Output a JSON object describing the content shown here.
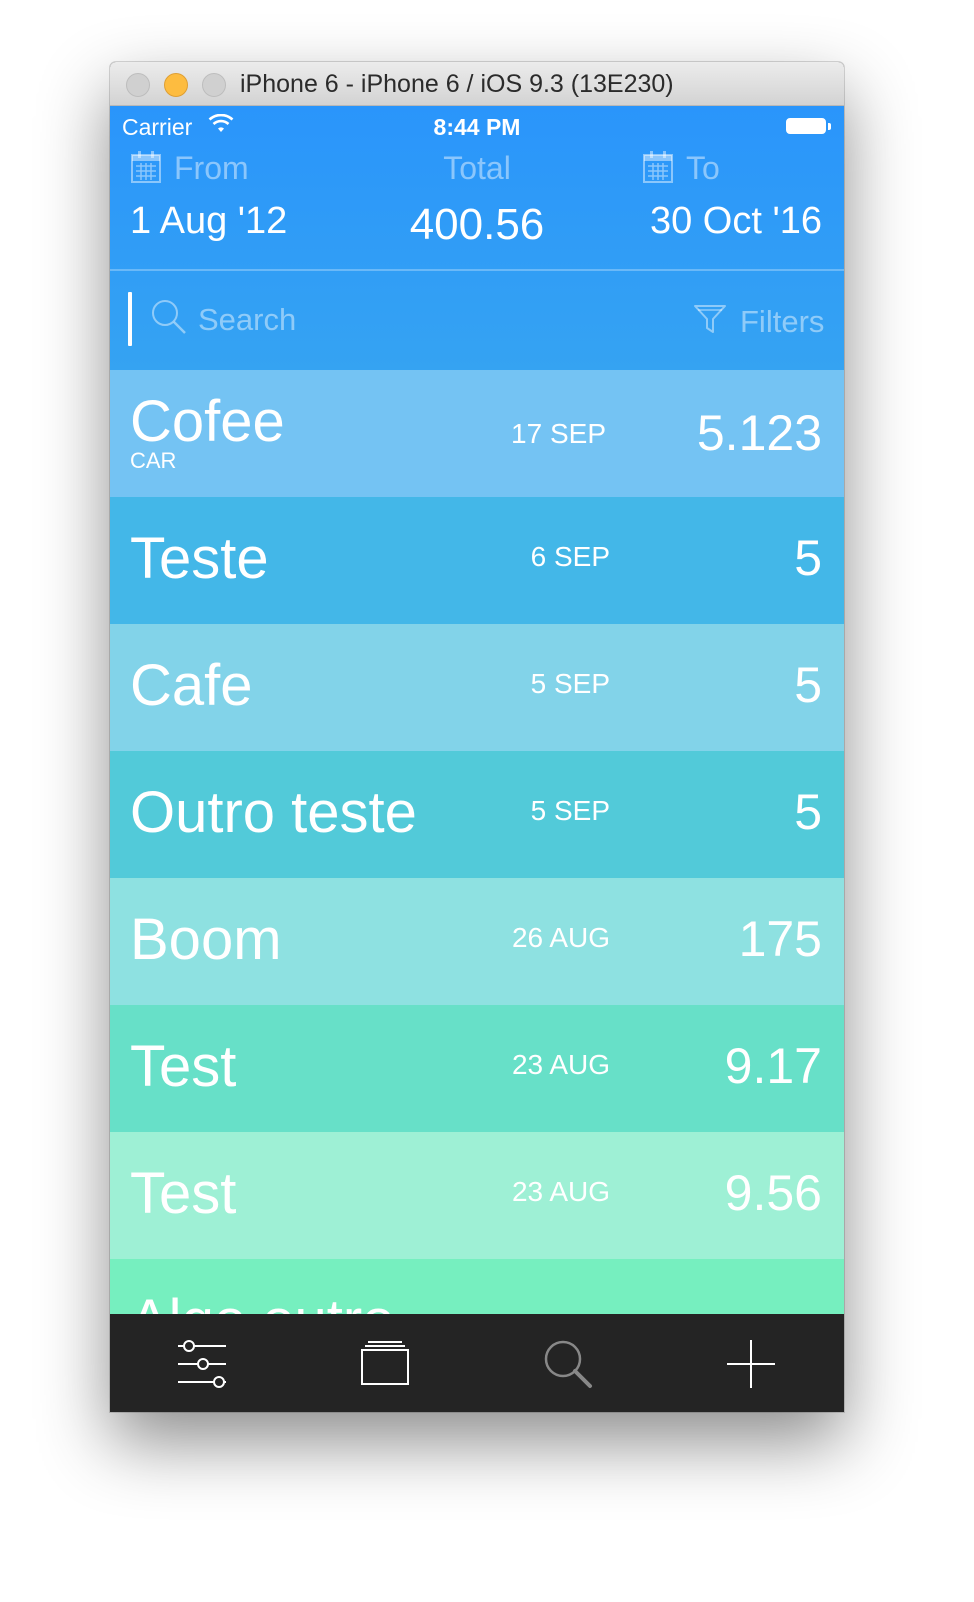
{
  "window": {
    "title": "iPhone 6 - iPhone 6 / iOS 9.3 (13E230)"
  },
  "status_bar": {
    "carrier": "Carrier",
    "time": "8:44 PM"
  },
  "header": {
    "from_label": "From",
    "from_value": "1 Aug '12",
    "total_label": "Total",
    "total_value": "400.56",
    "to_label": "To",
    "to_value": "30 Oct '16"
  },
  "search": {
    "placeholder": "Search",
    "filters_label": "Filters"
  },
  "rows": [
    {
      "name": "Cofee",
      "sub": "CAR",
      "date": "17 SEP",
      "amount": "5.123",
      "color": "#74c3f3"
    },
    {
      "name": "Teste",
      "sub": "",
      "date": "6 SEP",
      "amount": "5",
      "color": "#43b7e8"
    },
    {
      "name": "Cafe",
      "sub": "",
      "date": "5 SEP",
      "amount": "5",
      "color": "#82d3e9"
    },
    {
      "name": "Outro teste",
      "sub": "",
      "date": "5 SEP",
      "amount": "5",
      "color": "#52cad9"
    },
    {
      "name": "Boom",
      "sub": "",
      "date": "26 AUG",
      "amount": "175",
      "color": "#8ee1e1"
    },
    {
      "name": "Test",
      "sub": "",
      "date": "23 AUG",
      "amount": "9.17",
      "color": "#67e0c8"
    },
    {
      "name": "Test",
      "sub": "",
      "date": "23 AUG",
      "amount": "9.56",
      "color": "#9ef0d5"
    },
    {
      "name": "Algo outro",
      "sub": "",
      "date": "",
      "amount": "",
      "color": "#76efbf"
    }
  ],
  "tabbar": {
    "icons": [
      "sliders-icon",
      "stack-icon",
      "search-icon",
      "plus-icon"
    ]
  }
}
